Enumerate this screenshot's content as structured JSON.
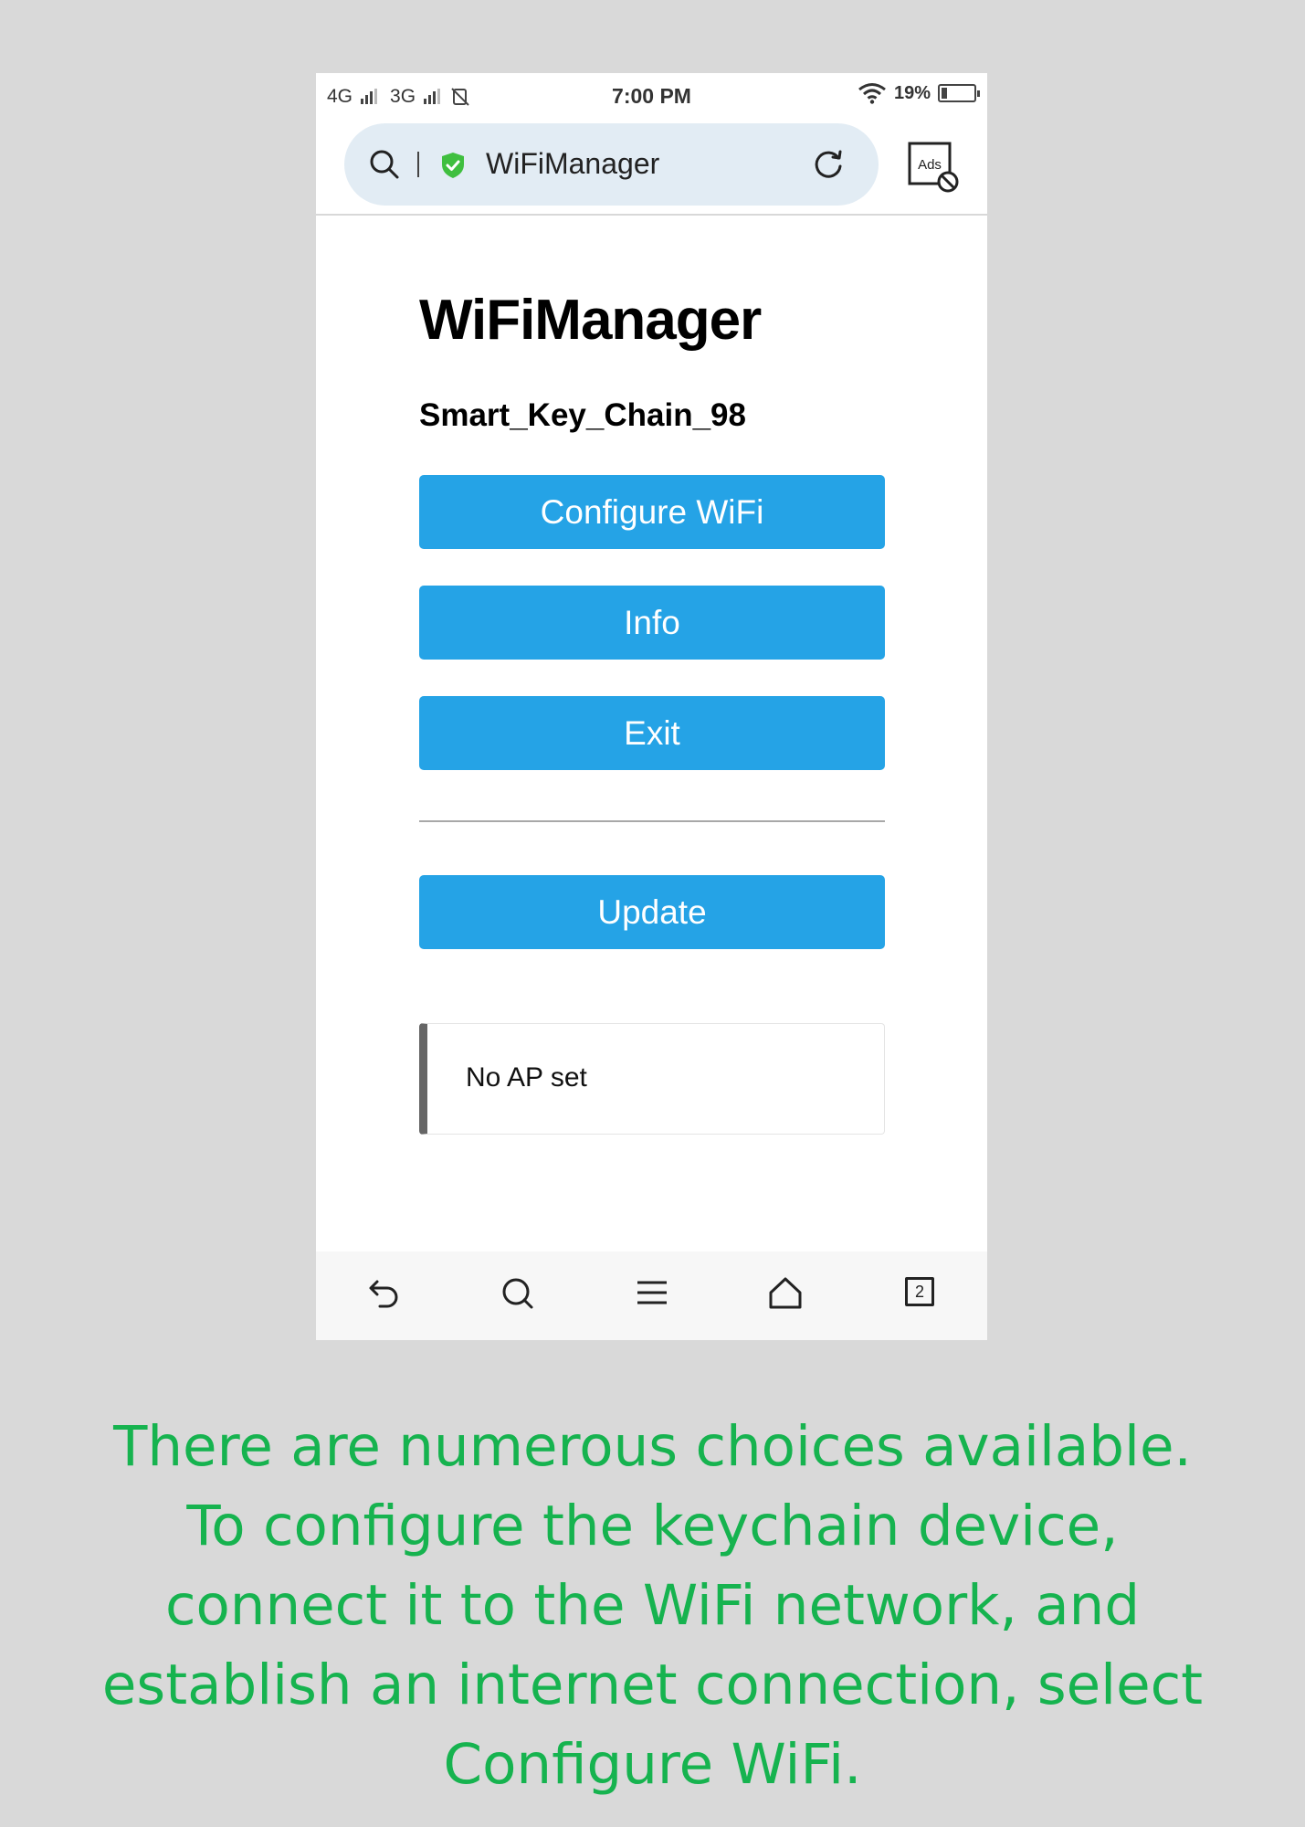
{
  "status_bar": {
    "net1": "4G",
    "net2": "3G",
    "time": "7:00 PM",
    "battery": "19%",
    "battery_level": 0.19
  },
  "browser": {
    "url_title": "WiFiManager",
    "ads_label": "Ads"
  },
  "page": {
    "title": "WiFiManager",
    "device_name": "Smart_Key_Chain_98",
    "buttons": {
      "configure": "Configure WiFi",
      "info": "Info",
      "exit": "Exit",
      "update": "Update"
    },
    "message": "No AP set"
  },
  "bottom_nav": {
    "tab_count": "2"
  },
  "caption": "There are numerous choices available. To configure the keychain device, connect it to the WiFi network, and establish an internet connection, select Configure WiFi.",
  "colors": {
    "button": "#25a3e6",
    "caption": "#16b34f",
    "shield": "#3fbf3f"
  }
}
